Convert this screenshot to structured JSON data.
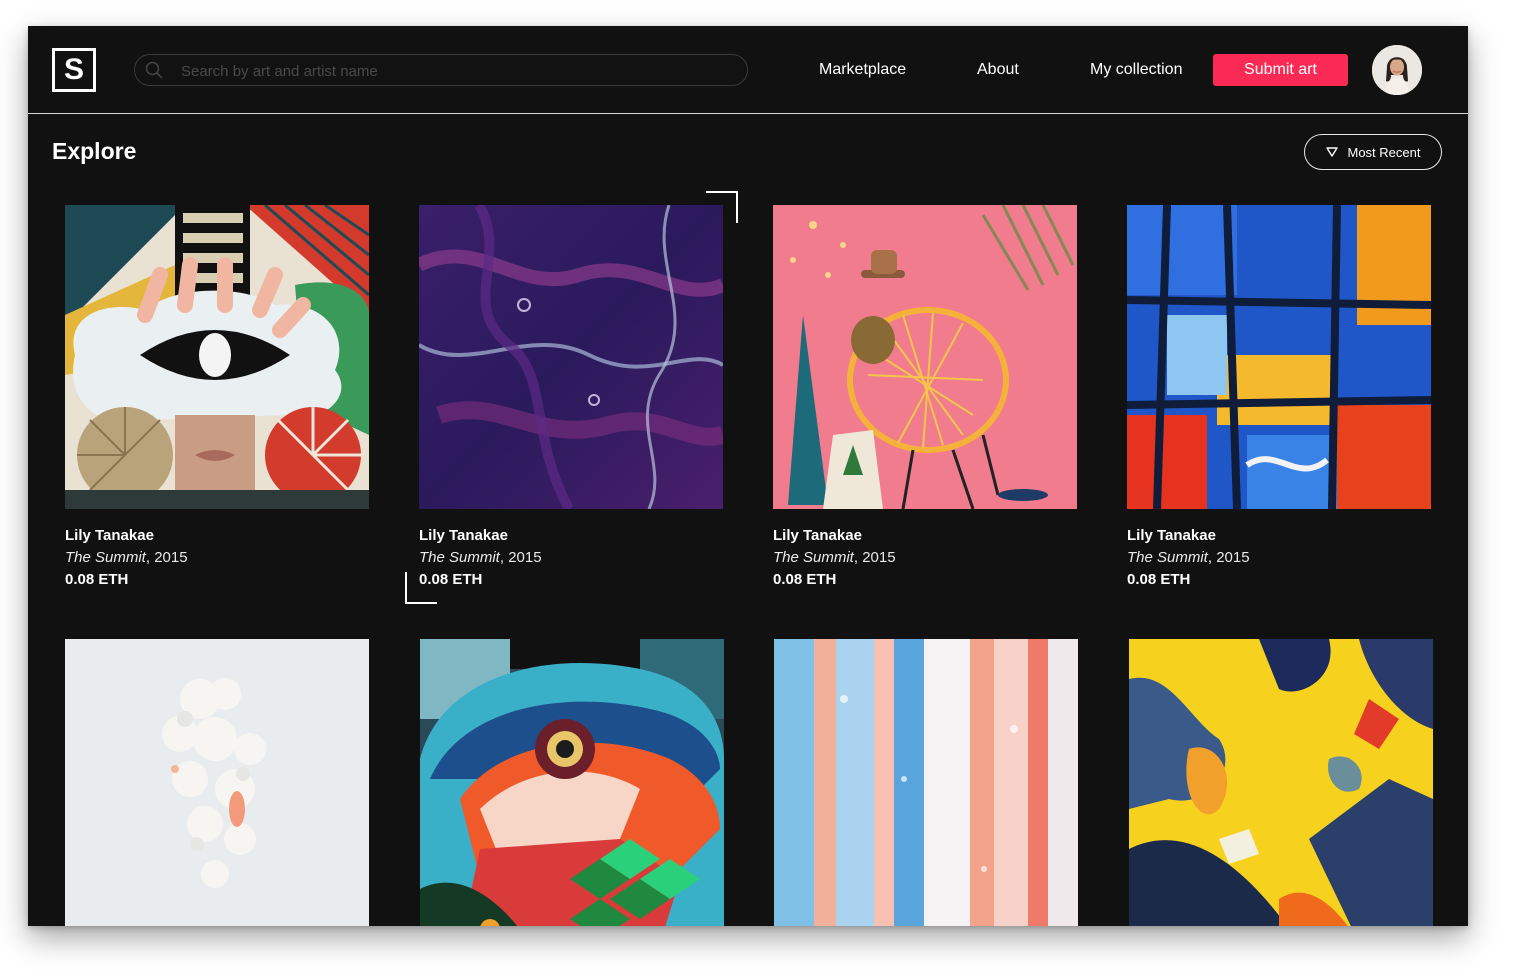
{
  "app": {
    "logo_letter": "S",
    "search": {
      "placeholder": "Search by art and artist name",
      "value": ""
    },
    "nav": {
      "marketplace": "Marketplace",
      "about": "About",
      "my_collection": "My collection",
      "submit_art": "Submit art"
    }
  },
  "explore": {
    "title": "Explore",
    "sort_label": "Most Recent",
    "cards": [
      {
        "artist": "Lily Tanakae",
        "title": "The Summit",
        "year": ", 2015",
        "price": "0.08 ETH"
      },
      {
        "artist": "Lily Tanakae",
        "title": "The Summit",
        "year": ", 2015",
        "price": "0.08 ETH"
      },
      {
        "artist": "Lily Tanakae",
        "title": "The Summit",
        "year": ", 2015",
        "price": "0.08 ETH"
      },
      {
        "artist": "Lily Tanakae",
        "title": "The Summit",
        "year": ", 2015",
        "price": "0.08 ETH"
      }
    ]
  },
  "colors": {
    "background": "#111111",
    "accent": "#fb2a55",
    "text": "#ffffff"
  },
  "icons": {
    "search": "search-icon",
    "sort": "triangle-down-icon",
    "avatar": "user-avatar"
  }
}
